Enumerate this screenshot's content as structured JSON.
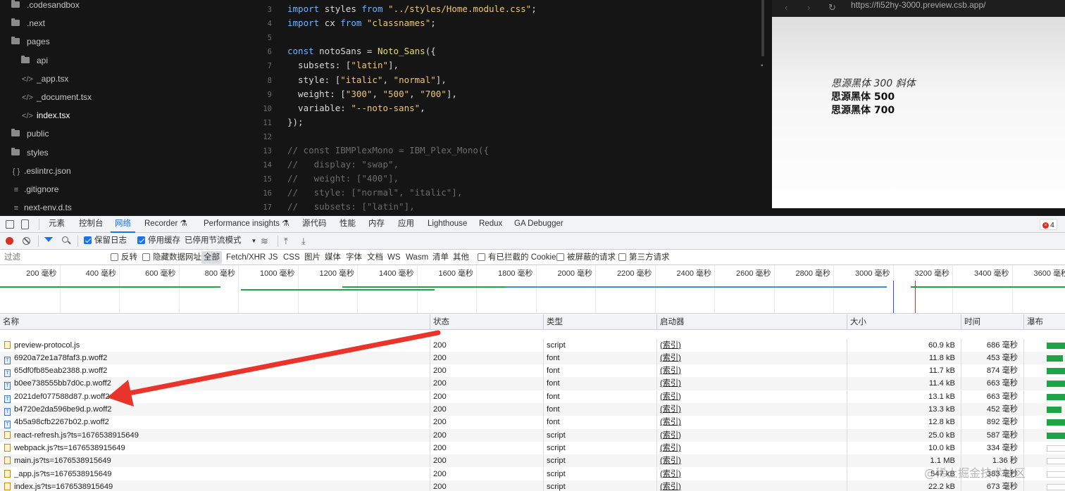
{
  "file_tree": [
    {
      "label": ".codesandbox",
      "type": "folder",
      "active": false
    },
    {
      "label": ".next",
      "type": "folder",
      "active": false
    },
    {
      "label": "pages",
      "type": "folder",
      "active": false
    },
    {
      "label": "api",
      "type": "folder",
      "active": false
    },
    {
      "label": "_app.tsx",
      "type": "file",
      "active": false
    },
    {
      "label": "_document.tsx",
      "type": "file",
      "active": false
    },
    {
      "label": "index.tsx",
      "type": "file",
      "active": true
    },
    {
      "label": "public",
      "type": "folder",
      "active": false
    },
    {
      "label": "styles",
      "type": "folder",
      "active": false
    },
    {
      "label": ".eslintrc.json",
      "type": "json",
      "active": false
    },
    {
      "label": ".gitignore",
      "type": "text",
      "active": false
    },
    {
      "label": "next-env.d.ts",
      "type": "text",
      "active": false
    }
  ],
  "code_lines": [
    {
      "n": "3",
      "tokens": [
        [
          "kw",
          "import "
        ],
        [
          "plain",
          "styles "
        ],
        [
          "kw",
          "from "
        ],
        [
          "str",
          "\"../styles/Home.module.css\""
        ],
        [
          "plain",
          ";"
        ]
      ]
    },
    {
      "n": "4",
      "tokens": [
        [
          "kw",
          "import "
        ],
        [
          "plain",
          "cx "
        ],
        [
          "kw",
          "from "
        ],
        [
          "str",
          "\"classnames\""
        ],
        [
          "plain",
          ";"
        ]
      ]
    },
    {
      "n": "5",
      "tokens": []
    },
    {
      "n": "6",
      "tokens": [
        [
          "kw",
          "const "
        ],
        [
          "plain",
          "notoSans = "
        ],
        [
          "fn",
          "Noto_Sans"
        ],
        [
          "plain",
          "({"
        ]
      ]
    },
    {
      "n": "7",
      "tokens": [
        [
          "plain",
          "  subsets: ["
        ],
        [
          "str",
          "\"latin\""
        ],
        [
          "plain",
          "],"
        ]
      ]
    },
    {
      "n": "8",
      "tokens": [
        [
          "plain",
          "  style: ["
        ],
        [
          "str",
          "\"italic\""
        ],
        [
          "plain",
          ", "
        ],
        [
          "str",
          "\"normal\""
        ],
        [
          "plain",
          "],"
        ]
      ]
    },
    {
      "n": "9",
      "tokens": [
        [
          "plain",
          "  weight: ["
        ],
        [
          "str",
          "\"300\""
        ],
        [
          "plain",
          ", "
        ],
        [
          "str",
          "\"500\""
        ],
        [
          "plain",
          ", "
        ],
        [
          "str",
          "\"700\""
        ],
        [
          "plain",
          "],"
        ]
      ]
    },
    {
      "n": "10",
      "tokens": [
        [
          "plain",
          "  variable: "
        ],
        [
          "str",
          "\"--noto-sans\""
        ],
        [
          "plain",
          ","
        ]
      ]
    },
    {
      "n": "11",
      "tokens": [
        [
          "plain",
          "});"
        ]
      ]
    },
    {
      "n": "12",
      "tokens": []
    },
    {
      "n": "13",
      "tokens": [
        [
          "cm",
          "// const IBMPlexMono = IBM_Plex_Mono({"
        ]
      ]
    },
    {
      "n": "14",
      "tokens": [
        [
          "cm",
          "//   display: \"swap\","
        ]
      ]
    },
    {
      "n": "15",
      "tokens": [
        [
          "cm",
          "//   weight: [\"400\"],"
        ]
      ]
    },
    {
      "n": "16",
      "tokens": [
        [
          "cm",
          "//   style: [\"normal\", \"italic\"],"
        ]
      ]
    },
    {
      "n": "17",
      "tokens": [
        [
          "cm",
          "//   subsets: [\"latin\"],"
        ]
      ]
    }
  ],
  "preview": {
    "url": "https://fi52hy-3000.preview.csb.app/",
    "lines": [
      "思源黑体 300 斜体",
      "思源黑体 500",
      "思源黑体 700"
    ]
  },
  "devtools": {
    "tabs": [
      "元素",
      "控制台",
      "网络",
      "Recorder ⚗",
      "Performance insights ⚗",
      "源代码",
      "性能",
      "内存",
      "应用",
      "Lighthouse",
      "Redux",
      "GA Debugger"
    ],
    "active_tab": "网络",
    "error_count": "4",
    "toolbar": {
      "preserve_log": "保留日志",
      "disable_cache": "停用缓存",
      "throttling": "已停用节流模式"
    },
    "filter": {
      "placeholder": "过滤",
      "invert": "反转",
      "hide_data_urls": "隐藏数据网址",
      "types": [
        "全部",
        "Fetch/XHR",
        "JS",
        "CSS",
        "图片",
        "媒体",
        "字体",
        "文档",
        "WS",
        "Wasm",
        "清单",
        "其他"
      ],
      "selected_type": "全部",
      "blocked_cookies": "有已拦截的 Cookie",
      "blocked_requests": "被屏蔽的请求",
      "third_party": "第三方请求"
    },
    "overview_ticks": [
      "200 毫秒",
      "400 毫秒",
      "600 毫秒",
      "800 毫秒",
      "1000 毫秒",
      "1200 毫秒",
      "1400 毫秒",
      "1600 毫秒",
      "1800 毫秒",
      "2000 毫秒",
      "2200 毫秒",
      "2400 毫秒",
      "2600 毫秒",
      "2800 毫秒",
      "3000 毫秒",
      "3200 毫秒",
      "3400 毫秒",
      "3600 毫秒"
    ],
    "columns": [
      "名称",
      "状态",
      "类型",
      "启动器",
      "大小",
      "时间",
      "瀑布"
    ],
    "rows": [
      {
        "name": "preview-protocol.js",
        "kind": "script",
        "status": "200",
        "type": "script",
        "initiator": "(索引)",
        "size": "60.9 kB",
        "time": "686 毫秒",
        "waterfall": 0.85
      },
      {
        "name": "6920a72e1a78faf3.p.woff2",
        "kind": "font",
        "status": "200",
        "type": "font",
        "initiator": "(索引)",
        "size": "11.8 kB",
        "time": "453 毫秒",
        "waterfall": 0.75
      },
      {
        "name": "65df0fb85eab2388.p.woff2",
        "kind": "font",
        "status": "200",
        "type": "font",
        "initiator": "(索引)",
        "size": "11.7 kB",
        "time": "874 毫秒",
        "waterfall": 0.85
      },
      {
        "name": "b0ee738555bb7d0c.p.woff2",
        "kind": "font",
        "status": "200",
        "type": "font",
        "initiator": "(索引)",
        "size": "11.4 kB",
        "time": "663 毫秒",
        "waterfall": 0.85
      },
      {
        "name": "2021def077588d87.p.woff2",
        "kind": "font",
        "status": "200",
        "type": "font",
        "initiator": "(索引)",
        "size": "13.1 kB",
        "time": "663 毫秒",
        "waterfall": 0.85
      },
      {
        "name": "b4720e2da596be9d.p.woff2",
        "kind": "font",
        "status": "200",
        "type": "font",
        "initiator": "(索引)",
        "size": "13.3 kB",
        "time": "452 毫秒",
        "waterfall": 0.7
      },
      {
        "name": "4b5a98cfb2267b02.p.woff2",
        "kind": "font",
        "status": "200",
        "type": "font",
        "initiator": "(索引)",
        "size": "12.8 kB",
        "time": "892 毫秒",
        "waterfall": 0.85
      },
      {
        "name": "react-refresh.js?ts=1676538915649",
        "kind": "script",
        "status": "200",
        "type": "script",
        "initiator": "(索引)",
        "size": "25.0 kB",
        "time": "587 毫秒",
        "waterfall": 0.85
      },
      {
        "name": "webpack.js?ts=1676538915649",
        "kind": "script",
        "status": "200",
        "type": "script",
        "initiator": "(索引)",
        "size": "10.0 kB",
        "time": "334 毫秒",
        "waterfall": 0
      },
      {
        "name": "main.js?ts=1676538915649",
        "kind": "script",
        "status": "200",
        "type": "script",
        "initiator": "(索引)",
        "size": "1.1 MB",
        "time": "1.36 秒",
        "waterfall": 0
      },
      {
        "name": "_app.js?ts=1676538915649",
        "kind": "script",
        "status": "200",
        "type": "script",
        "initiator": "(索引)",
        "size": "547 kB",
        "time": "383 毫秒",
        "waterfall": 0
      },
      {
        "name": "index.js?ts=1676538915649",
        "kind": "script",
        "status": "200",
        "type": "script",
        "initiator": "(索引)",
        "size": "22.2 kB",
        "time": "673 毫秒",
        "waterfall": 0
      }
    ]
  },
  "watermark": "@稀土掘金技术社区",
  "colors": {
    "accent": "#1a73e8",
    "arrow": "#e8342b",
    "waterfall": "#1ea446"
  }
}
